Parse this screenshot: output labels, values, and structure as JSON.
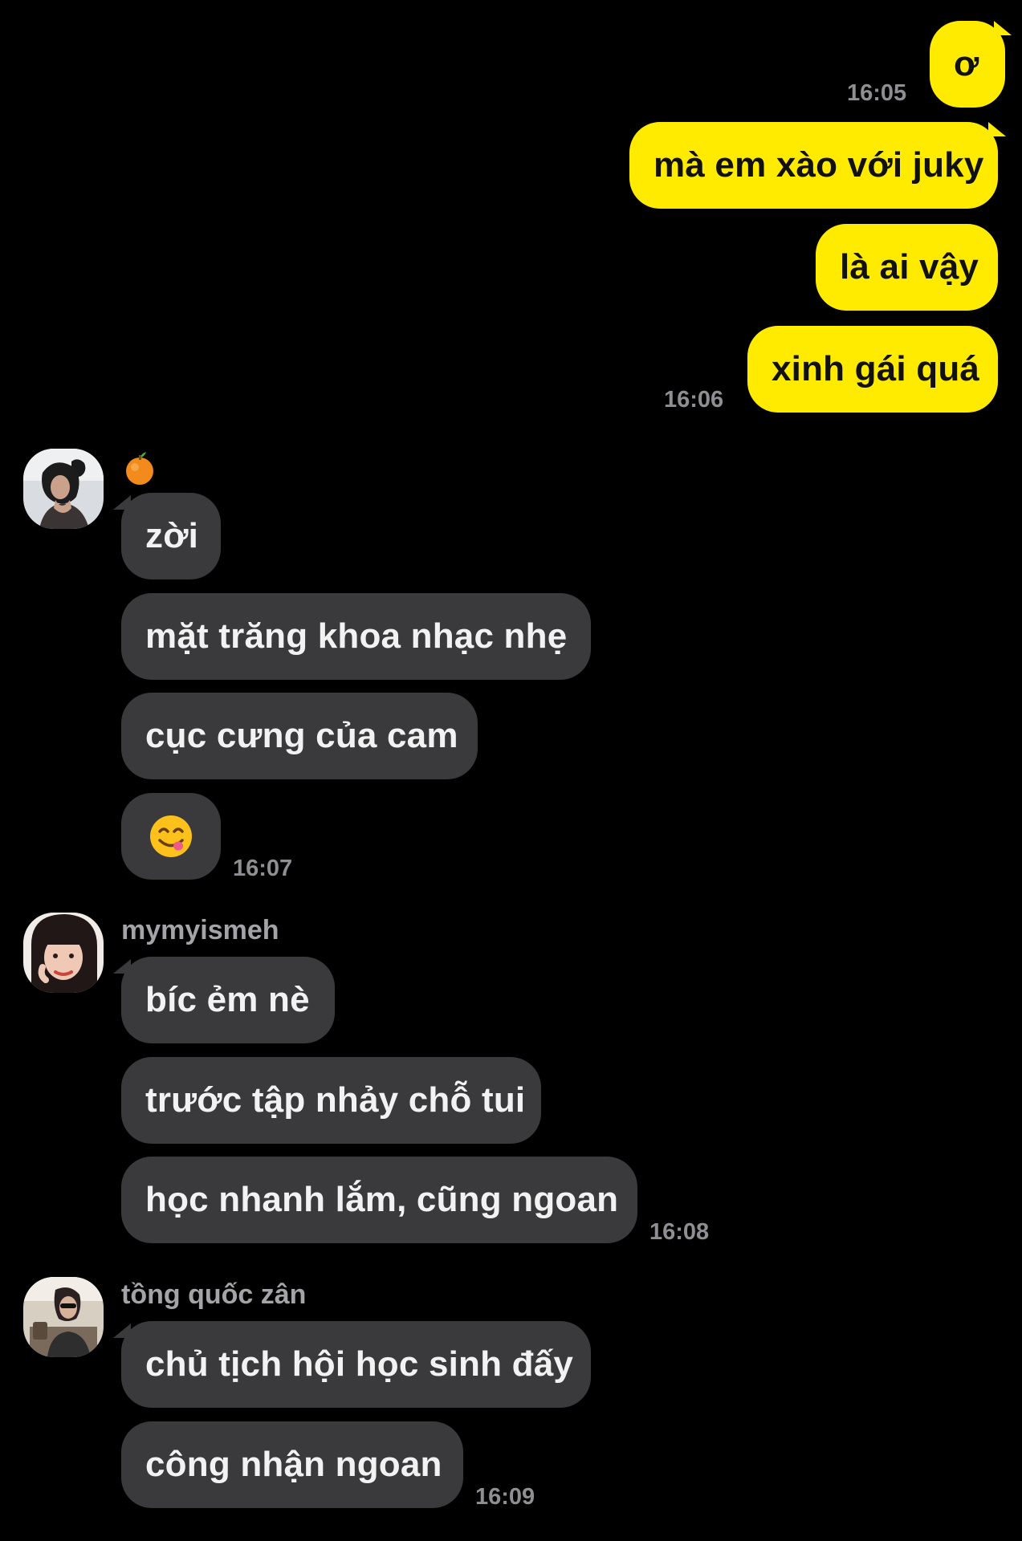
{
  "conversation": {
    "outgoing": [
      {
        "text": "ơ",
        "time": "16:05"
      },
      {
        "text": "mà em xào với juky"
      },
      {
        "text": "là ai vậy"
      },
      {
        "text": "xinh gái quá",
        "time": "16:06"
      }
    ],
    "group1": {
      "messages": [
        {
          "text": "zời"
        },
        {
          "text": "mặt trăng khoa nhạc nhẹ"
        },
        {
          "text": "cục cưng của cam"
        },
        {
          "emoji": "yum-face-emoji"
        }
      ],
      "time": "16:07"
    },
    "group2": {
      "sender": "mymyismeh",
      "messages": [
        {
          "text": "bíc ẻm nè"
        },
        {
          "text": "trước tập nhảy chỗ tui"
        },
        {
          "text": "học nhanh lắm, cũng ngoan"
        }
      ],
      "time": "16:08"
    },
    "group3": {
      "sender": "tồng quốc zân",
      "messages": [
        {
          "text": "chủ tịch hội học sinh đấy"
        },
        {
          "text": "công nhận ngoan"
        }
      ],
      "time": "16:09"
    }
  },
  "colors": {
    "background": "#000000",
    "outgoing_bubble": "#ffeb00",
    "incoming_bubble": "#3a3a3c",
    "timestamp": "#8e8e93",
    "sender_name": "#a3a3a8"
  }
}
